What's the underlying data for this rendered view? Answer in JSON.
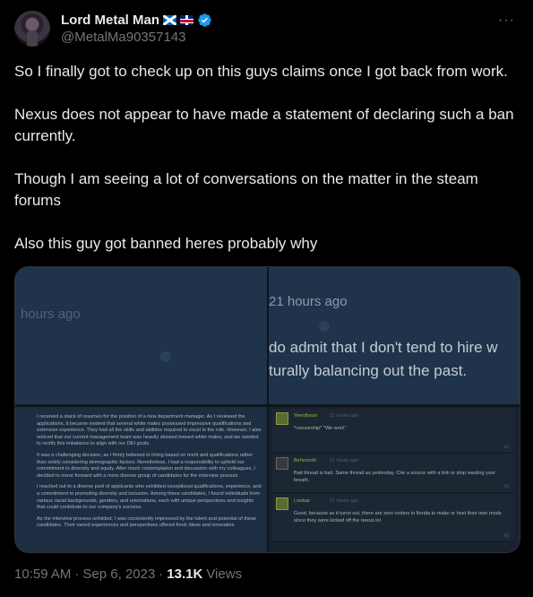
{
  "author": {
    "display_name": "Lord Metal Man",
    "handle": "@MetalMa90357143",
    "flag_1": "scotland-flag",
    "flag_2": "uk-flag",
    "verified": true,
    "accent": "#1d9bf0"
  },
  "more_label": "···",
  "tweet": {
    "paragraphs": [
      "So I finally got to check up on this guys claims once I got back from work.",
      "Nexus does not appear to have made a statement of declaring such a ban currently.",
      "Though I am seeing a lot of conversations on the matter in the steam forums",
      "Also this guy got banned heres probably why"
    ]
  },
  "media": {
    "top_left": {
      "time": "hours ago"
    },
    "top_right": {
      "time": "21 hours ago",
      "line_1": "do admit that I don't tend to hire w",
      "line_2": "turally balancing out the past."
    },
    "bottom_left": {
      "paragraphs": [
        "I received a stack of resumes for the position of a new department manager. As I reviewed the applications, it became evident that several white males possessed impressive qualifications and extensive experience. They had all the skills and abilities required to excel in the role. However, I also noticed that our current management team was heavily skewed toward white males, and we needed to rectify this imbalance to align with our DEI goals.",
        "It was a challenging decision, as I firmly believed in hiring based on merit and qualifications rather than solely considering demographic factors. Nonetheless, I had a responsibility to uphold our commitment to diversity and equity. After much contemplation and discussion with my colleagues, I decided to move forward with a more diverse group of candidates for the interview process.",
        "I reached out to a diverse pool of applicants who exhibited exceptional qualifications, experience, and a commitment to promoting diversity and inclusion. Among these candidates, I found individuals from various racial backgrounds, genders, and orientations, each with unique perspectives and insights that could contribute to our company's success.",
        "As the interview process unfolded, I was consistently impressed by the talent and potential of these candidates. Their varied experiences and perspectives offered fresh ideas and innovative"
      ]
    },
    "bottom_right": {
      "posts": [
        {
          "user": "Yeerdbean",
          "date": "21 hours ago",
          "body": "*censorship* \"We won!\"",
          "num": "#1"
        },
        {
          "user": "Behemoth",
          "date": "21 hours ago",
          "body": "Bait thread is bait. Same thread as yesterday. Cite a source with a link or stop wasting your breath.",
          "num": "#2"
        },
        {
          "user": "Lowbar",
          "date": "21 hours ago",
          "body": "Good, because as it turns out, there are zero coders in florida to make or host their own mods since they were kicked off the nexus lol",
          "num": "#3"
        }
      ]
    }
  },
  "footer": {
    "time": "10:59 AM",
    "sep1": "·",
    "date": "Sep 6, 2023",
    "sep2": "·",
    "views_count": "13.1K",
    "views_label": "Views"
  }
}
